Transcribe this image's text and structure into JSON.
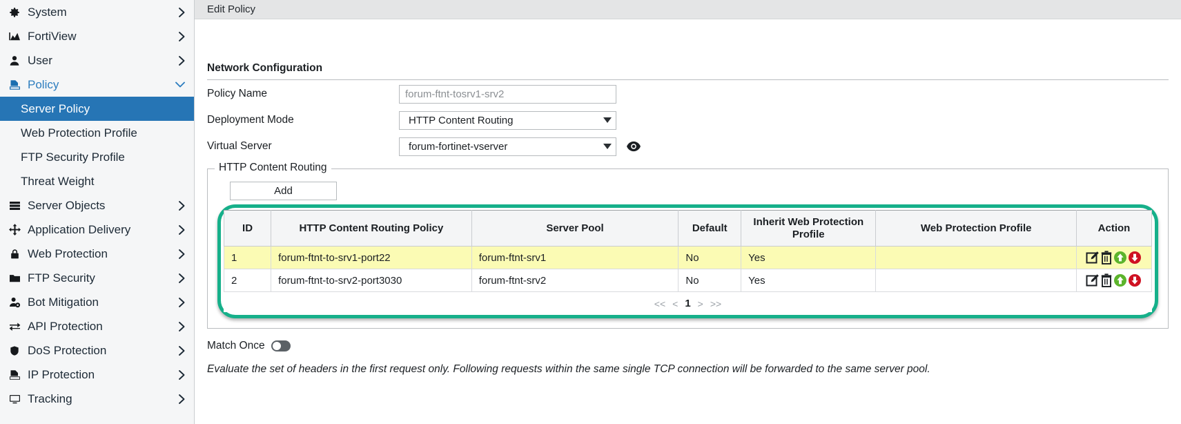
{
  "sidebar": {
    "items": [
      {
        "label": "System",
        "icon": "gear-icon",
        "chevron": "chevron-right-icon",
        "level": "top",
        "state": "collapsed"
      },
      {
        "label": "FortiView",
        "icon": "chart-icon",
        "chevron": "chevron-right-icon",
        "level": "top",
        "state": "collapsed"
      },
      {
        "label": "User",
        "icon": "user-icon",
        "chevron": "chevron-right-icon",
        "level": "top",
        "state": "collapsed"
      },
      {
        "label": "Policy",
        "icon": "policy-icon",
        "chevron": "chevron-down-icon",
        "level": "top",
        "state": "expanded"
      },
      {
        "label": "Server Policy",
        "icon": "",
        "chevron": "",
        "level": "sub",
        "state": "active"
      },
      {
        "label": "Web Protection Profile",
        "icon": "",
        "chevron": "",
        "level": "sub",
        "state": "normal"
      },
      {
        "label": "FTP Security Profile",
        "icon": "",
        "chevron": "",
        "level": "sub",
        "state": "normal"
      },
      {
        "label": "Threat Weight",
        "icon": "",
        "chevron": "",
        "level": "sub",
        "state": "normal"
      },
      {
        "label": "Server Objects",
        "icon": "server-icon",
        "chevron": "chevron-right-icon",
        "level": "top",
        "state": "collapsed"
      },
      {
        "label": "Application Delivery",
        "icon": "move-arrows-icon",
        "chevron": "chevron-right-icon",
        "level": "top",
        "state": "collapsed"
      },
      {
        "label": "Web Protection",
        "icon": "lock-icon",
        "chevron": "chevron-right-icon",
        "level": "top",
        "state": "collapsed"
      },
      {
        "label": "FTP Security",
        "icon": "folder-icon",
        "chevron": "chevron-right-icon",
        "level": "top",
        "state": "collapsed"
      },
      {
        "label": "Bot Mitigation",
        "icon": "user-gear-icon",
        "chevron": "chevron-right-icon",
        "level": "top",
        "state": "collapsed"
      },
      {
        "label": "API Protection",
        "icon": "exchange-arrows-icon",
        "chevron": "chevron-right-icon",
        "level": "top",
        "state": "collapsed"
      },
      {
        "label": "DoS Protection",
        "icon": "shield-icon",
        "chevron": "chevron-right-icon",
        "level": "top",
        "state": "collapsed"
      },
      {
        "label": "IP Protection",
        "icon": "policy-icon",
        "chevron": "chevron-right-icon",
        "level": "top",
        "state": "collapsed"
      },
      {
        "label": "Tracking",
        "icon": "monitor-icon",
        "chevron": "chevron-right-icon",
        "level": "top",
        "state": "collapsed"
      }
    ]
  },
  "header": {
    "title": "Edit Policy"
  },
  "form": {
    "section_title": "Network Configuration",
    "policy_name": {
      "label": "Policy Name",
      "value": "forum-ftnt-tosrv1-srv2",
      "placeholder": "forum-ftnt-tosrv1-srv2"
    },
    "deployment_mode": {
      "label": "Deployment Mode",
      "value": "HTTP Content Routing"
    },
    "virtual_server": {
      "label": "Virtual Server",
      "value": "forum-fortinet-vserver",
      "detail_icon": "eye-icon"
    }
  },
  "hcr": {
    "legend": "HTTP Content Routing",
    "add_label": "Add",
    "columns": [
      "ID",
      "HTTP Content Routing Policy",
      "Server Pool",
      "Default",
      "Inherit Web Protection Profile",
      "Web Protection Profile",
      "Action"
    ],
    "rows": [
      {
        "id": "1",
        "policy": "forum-ftnt-to-srv1-port22",
        "server_pool": "forum-ftnt-srv1",
        "default": "No",
        "inherit_wpp": "Yes",
        "wpp": "",
        "actions": [
          "edit-icon",
          "delete-icon",
          "move-up-icon",
          "move-down-icon"
        ],
        "highlighted": true
      },
      {
        "id": "2",
        "policy": "forum-ftnt-to-srv2-port3030",
        "server_pool": "forum-ftnt-srv2",
        "default": "No",
        "inherit_wpp": "Yes",
        "wpp": "",
        "actions": [
          "edit-icon",
          "delete-icon",
          "move-up-icon",
          "move-down-icon"
        ],
        "highlighted": false
      }
    ],
    "pagination": {
      "first": "<<",
      "prev": "<",
      "current": "1",
      "next": ">",
      "last": ">>"
    },
    "highlight_color": "#16b08a"
  },
  "match_once": {
    "label": "Match Once",
    "enabled": false,
    "hint": "Evaluate the set of headers in the first request only. Following requests within the same single TCP connection will be forwarded to the same server pool."
  }
}
